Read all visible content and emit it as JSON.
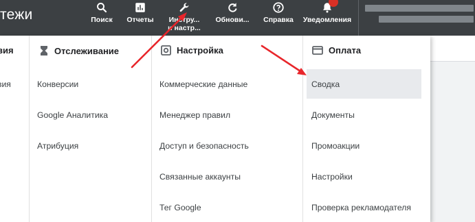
{
  "header": {
    "title": "тежи",
    "buttons": [
      {
        "label": "Поиск",
        "label2": "",
        "icon": "search-icon"
      },
      {
        "label": "Отчеты",
        "label2": "",
        "icon": "reports-icon"
      },
      {
        "label": "Инстру...",
        "label2": "и настр...",
        "icon": "wrench-icon"
      },
      {
        "label": "Обнови...",
        "label2": "",
        "icon": "refresh-icon"
      },
      {
        "label": "Справка",
        "label2": "",
        "icon": "help-icon"
      },
      {
        "label": "Уведомления",
        "label2": "",
        "icon": "bell-icon"
      }
    ],
    "notification_dot_color": "#d93025"
  },
  "menu": {
    "col0": {
      "heading": "вия",
      "items": [
        "вия"
      ]
    },
    "col1": {
      "heading": "Отслеживание",
      "icon": "hourglass-icon",
      "items": [
        "Конверсии",
        "Google Аналитика",
        "Атрибуция"
      ]
    },
    "col2": {
      "heading": "Настройка",
      "icon": "settings-box-icon",
      "items": [
        "Коммерческие данные",
        "Менеджер правил",
        "Доступ и безопасность",
        "Связанные аккаунты",
        "Тег Google"
      ]
    },
    "col3": {
      "heading": "Оплата",
      "icon": "credit-card-icon",
      "items": [
        "Сводка",
        "Документы",
        "Промоакции",
        "Настройки",
        "Проверка рекламодателя"
      ],
      "selected": "Сводка"
    }
  },
  "annotations": {
    "arrow_color": "#e8262b"
  }
}
